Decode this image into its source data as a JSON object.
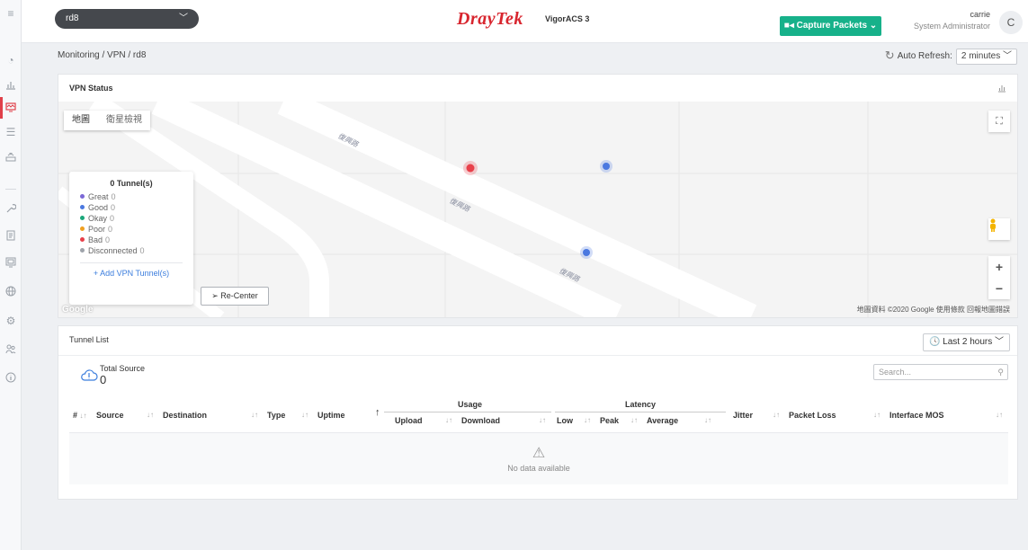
{
  "topbar": {
    "device_selector": "rd8",
    "logo_brand": "DrayTek",
    "logo_product": "VigorACS 3",
    "capture_label": "Capture Packets",
    "user_name": "carrie",
    "user_role": "System Administrator",
    "avatar_letter": "C"
  },
  "breadcrumb": "Monitoring / VPN / rd8",
  "auto_refresh": {
    "label": "Auto Refresh:",
    "value": "2 minutes"
  },
  "vpn_status": {
    "title": "VPN Status",
    "map_types": [
      "地圖",
      "衛星檢視"
    ],
    "legend": {
      "title": "0 Tunnel(s)",
      "items": [
        {
          "label": "Great",
          "count": "0",
          "color": "#7b68d6"
        },
        {
          "label": "Good",
          "count": "0",
          "color": "#4a78e0"
        },
        {
          "label": "Okay",
          "count": "0",
          "color": "#1aa77a"
        },
        {
          "label": "Poor",
          "count": "0",
          "color": "#f0a020"
        },
        {
          "label": "Bad",
          "count": "0",
          "color": "#e8404a"
        },
        {
          "label": "Disconnected",
          "count": "0",
          "color": "#9ea3aa"
        }
      ],
      "add_link": "+ Add VPN Tunnel(s)"
    },
    "recenter": "Re-Center",
    "google_mark": "Google",
    "map_copyright": "地圖資料 ©2020 Google  使用條款  回報地圖錯誤",
    "road_label": "復興路"
  },
  "tunnel_list": {
    "title": "Tunnel List",
    "time_range": "Last 2 hours",
    "total_label": "Total Source",
    "total_value": "0",
    "search_placeholder": "Search...",
    "columns": {
      "index": "#",
      "source": "Source",
      "destination": "Destination",
      "type": "Type",
      "uptime": "Uptime",
      "usage": "Usage",
      "upload": "Upload",
      "download": "Download",
      "latency": "Latency",
      "low": "Low",
      "peak": "Peak",
      "average": "Average",
      "jitter": "Jitter",
      "packet_loss": "Packet Loss",
      "interface_mos": "Interface MOS"
    },
    "empty_text": "No data available"
  },
  "icons": {
    "menu": "hamburger-icon",
    "rail": [
      "dashboard-icon",
      "chart-icon",
      "monitor-icon",
      "sliders-icon",
      "router-icon",
      "wrench-icon",
      "report-icon",
      "screen-icon",
      "globe-icon",
      "gear-icon",
      "users-icon",
      "info-icon"
    ]
  }
}
